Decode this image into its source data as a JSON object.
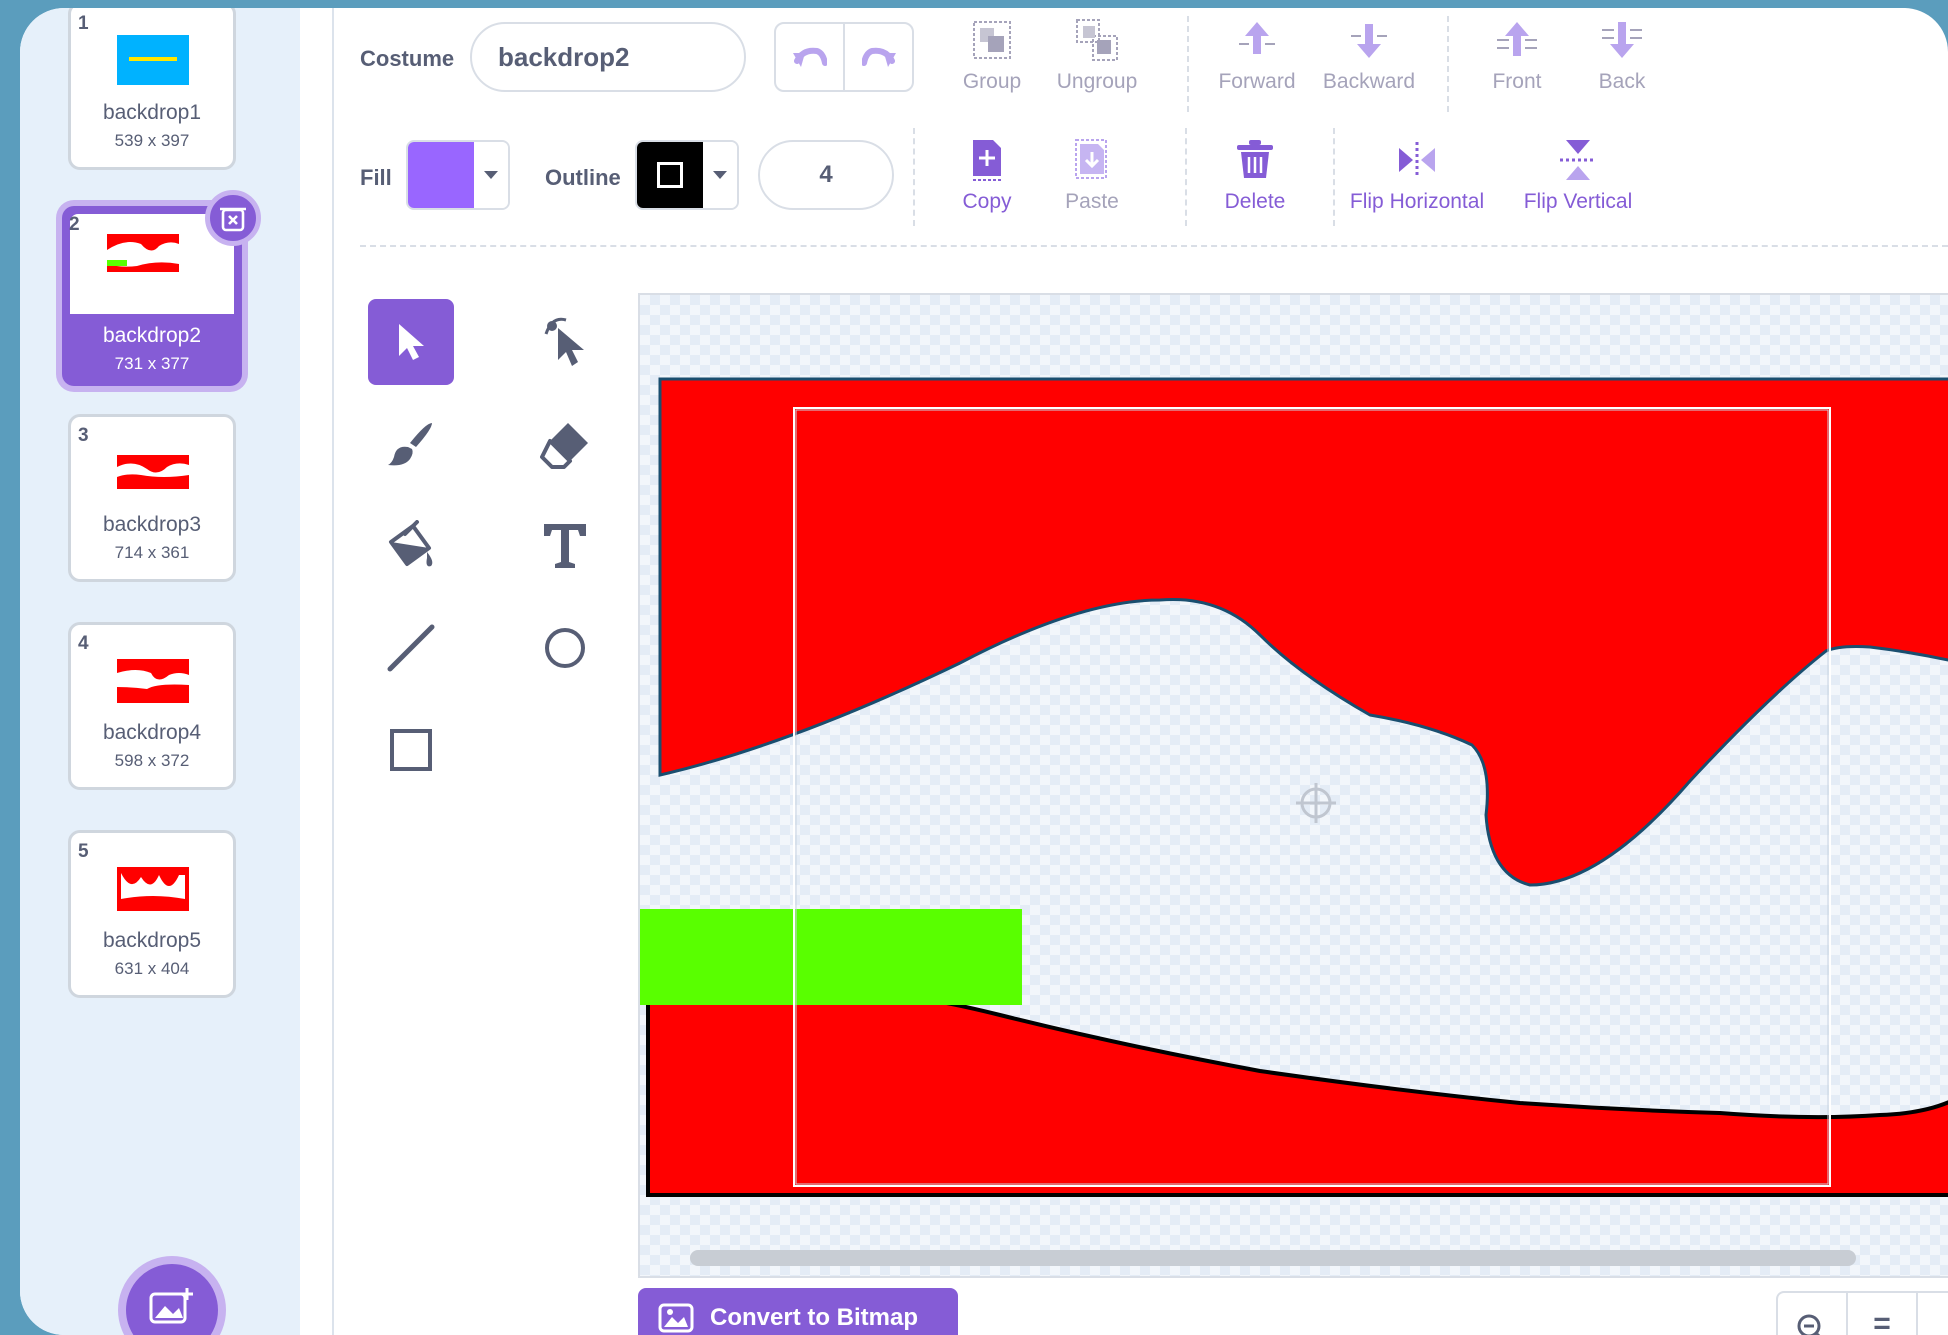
{
  "costumes": [
    {
      "number": "1",
      "name": "backdrop1",
      "size": "539 x 397"
    },
    {
      "number": "2",
      "name": "backdrop2",
      "size": "731 x 377"
    },
    {
      "number": "3",
      "name": "backdrop3",
      "size": "714 x 361"
    },
    {
      "number": "4",
      "name": "backdrop4",
      "size": "598 x 372"
    },
    {
      "number": "5",
      "name": "backdrop5",
      "size": "631 x 404"
    }
  ],
  "selected_costume": "2",
  "toolbar": {
    "costume_label": "Costume",
    "costume_name": "backdrop2",
    "group": "Group",
    "ungroup": "Ungroup",
    "forward": "Forward",
    "backward": "Backward",
    "front": "Front",
    "back": "Back",
    "fill_label": "Fill",
    "outline_label": "Outline",
    "outline_width": "4",
    "copy": "Copy",
    "paste": "Paste",
    "delete": "Delete",
    "flip_horizontal": "Flip Horizontal",
    "flip_vertical": "Flip Vertical"
  },
  "colors": {
    "accent": "#855cd6",
    "fill": "#9966ff",
    "outline": "#000000",
    "shape_red": "#ff0000",
    "shape_green": "#59ff00"
  },
  "tools": [
    "select-icon",
    "reshape-icon",
    "brush-icon",
    "eraser-icon",
    "fill-icon",
    "text-icon",
    "line-icon",
    "circle-icon",
    "rectangle-icon"
  ],
  "convert_button": "Convert to Bitmap",
  "zoom": {
    "zoom_out": "zoom-out-icon",
    "reset": "="
  }
}
